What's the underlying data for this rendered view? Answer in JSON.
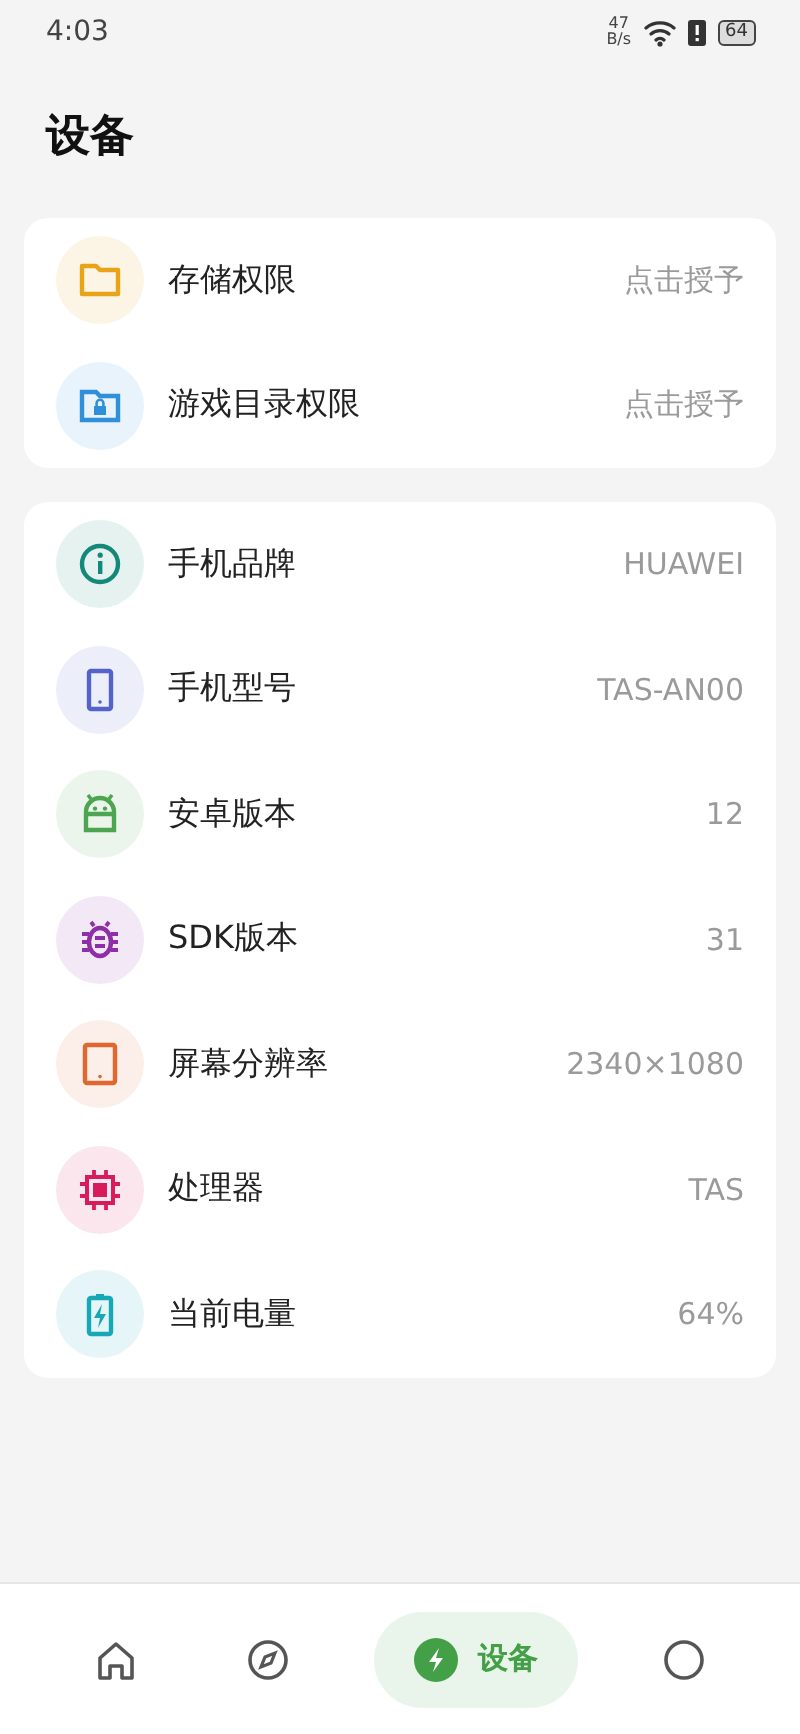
{
  "status_bar": {
    "time": "4:03",
    "net_speed": "47",
    "net_unit": "B/s",
    "battery": "64"
  },
  "title": "设备",
  "permissions": [
    {
      "color": "#e8a317",
      "label": "存储权限",
      "value": "点击授予"
    },
    {
      "color": "#2f8fd8",
      "label": "游戏目录权限",
      "value": "点击授予"
    }
  ],
  "device_info": [
    {
      "color": "#14897a",
      "label": "手机品牌",
      "value": "HUAWEI"
    },
    {
      "color": "#5463c9",
      "label": "手机型号",
      "value": "TAS-AN00"
    },
    {
      "color": "#4ca54f",
      "label": "安卓版本",
      "value": "12"
    },
    {
      "color": "#8e2fa8",
      "label": "SDK版本",
      "value": "31"
    },
    {
      "color": "#e0672f",
      "label": "屏幕分辨率",
      "value": "2340×1080"
    },
    {
      "color": "#d81b5c",
      "label": "处理器",
      "value": "TAS"
    },
    {
      "color": "#17a8b8",
      "label": "当前电量",
      "value": "64%"
    }
  ],
  "nav": [
    {
      "selected": false
    },
    {
      "selected": false
    },
    {
      "label": "设备",
      "selected": true
    },
    {
      "selected": false
    }
  ]
}
